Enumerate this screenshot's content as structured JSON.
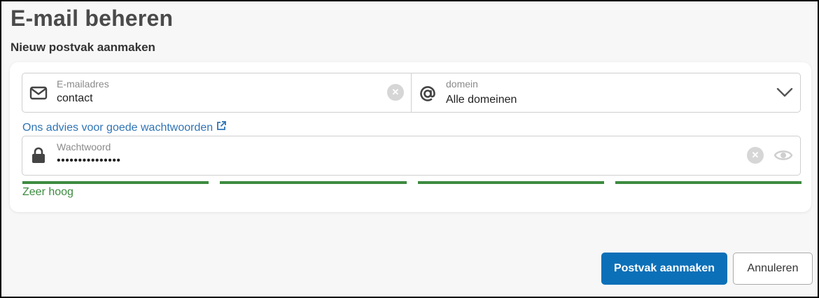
{
  "page": {
    "title": "E-mail beheren",
    "section_title": "Nieuw postvak aanmaken"
  },
  "email": {
    "label": "E-mailadres",
    "value": "contact",
    "icon": "envelope-icon"
  },
  "domain": {
    "label": "domein",
    "value": "Alle domeinen",
    "icon": "at-sign-icon"
  },
  "advice_link": {
    "label": "Ons advies voor goede wachtwoorden",
    "icon": "external-link-icon"
  },
  "password": {
    "label": "Wachtwoord",
    "value": "•••••••••••••••",
    "icon": "lock-icon"
  },
  "strength": {
    "label": "Zeer hoog",
    "filled_segments": 4,
    "total_segments": 4,
    "color": "#3d8b40"
  },
  "actions": {
    "create_label": "Postvak aanmaken",
    "cancel_label": "Annuleren"
  },
  "colors": {
    "primary": "#0c70b8",
    "link": "#2f74b5",
    "success": "#3d8b40"
  }
}
